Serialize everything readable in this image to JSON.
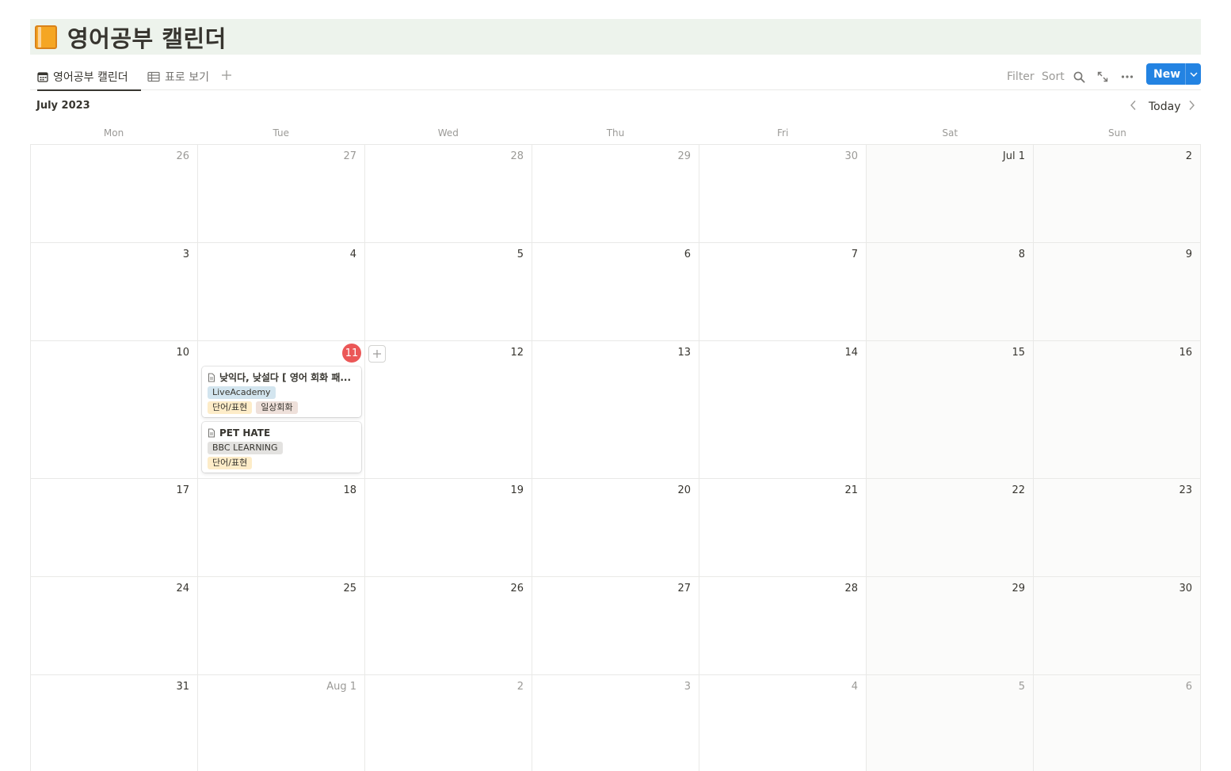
{
  "page": {
    "title": "영어공부 캘린더",
    "icon": "orange-book-icon"
  },
  "views": {
    "tabs": [
      {
        "label": "영어공부 캘린더",
        "icon": "calendar-icon",
        "active": true
      },
      {
        "label": "표로 보기",
        "icon": "table-icon",
        "active": false
      }
    ]
  },
  "toolbar": {
    "filter": "Filter",
    "sort": "Sort",
    "new_label": "New",
    "accent": "#2383e2"
  },
  "calendar": {
    "month_label": "July 2023",
    "today_label": "Today",
    "weekdays": [
      "Mon",
      "Tue",
      "Wed",
      "Thu",
      "Fri",
      "Sat",
      "Sun"
    ],
    "weeks": [
      [
        "26",
        "27",
        "28",
        "29",
        "30",
        "Jul 1",
        "2"
      ],
      [
        "3",
        "4",
        "5",
        "6",
        "7",
        "8",
        "9"
      ],
      [
        "10",
        "11",
        "12",
        "13",
        "14",
        "15",
        "16"
      ],
      [
        "17",
        "18",
        "19",
        "20",
        "21",
        "22",
        "23"
      ],
      [
        "24",
        "25",
        "26",
        "27",
        "28",
        "29",
        "30"
      ],
      [
        "31",
        "Aug 1",
        "2",
        "3",
        "4",
        "5",
        "6"
      ]
    ],
    "today": "11",
    "today_color": "#eb5757",
    "events": [
      {
        "title": "낮익다, 낮설다 [ 영어 회화 패...",
        "source": "LiveAcademy",
        "tags": [
          "단어/표현",
          "일상회화"
        ]
      },
      {
        "title": "PET HATE",
        "source": "BBC LEARNING",
        "tags": [
          "단어/표현"
        ]
      }
    ]
  }
}
